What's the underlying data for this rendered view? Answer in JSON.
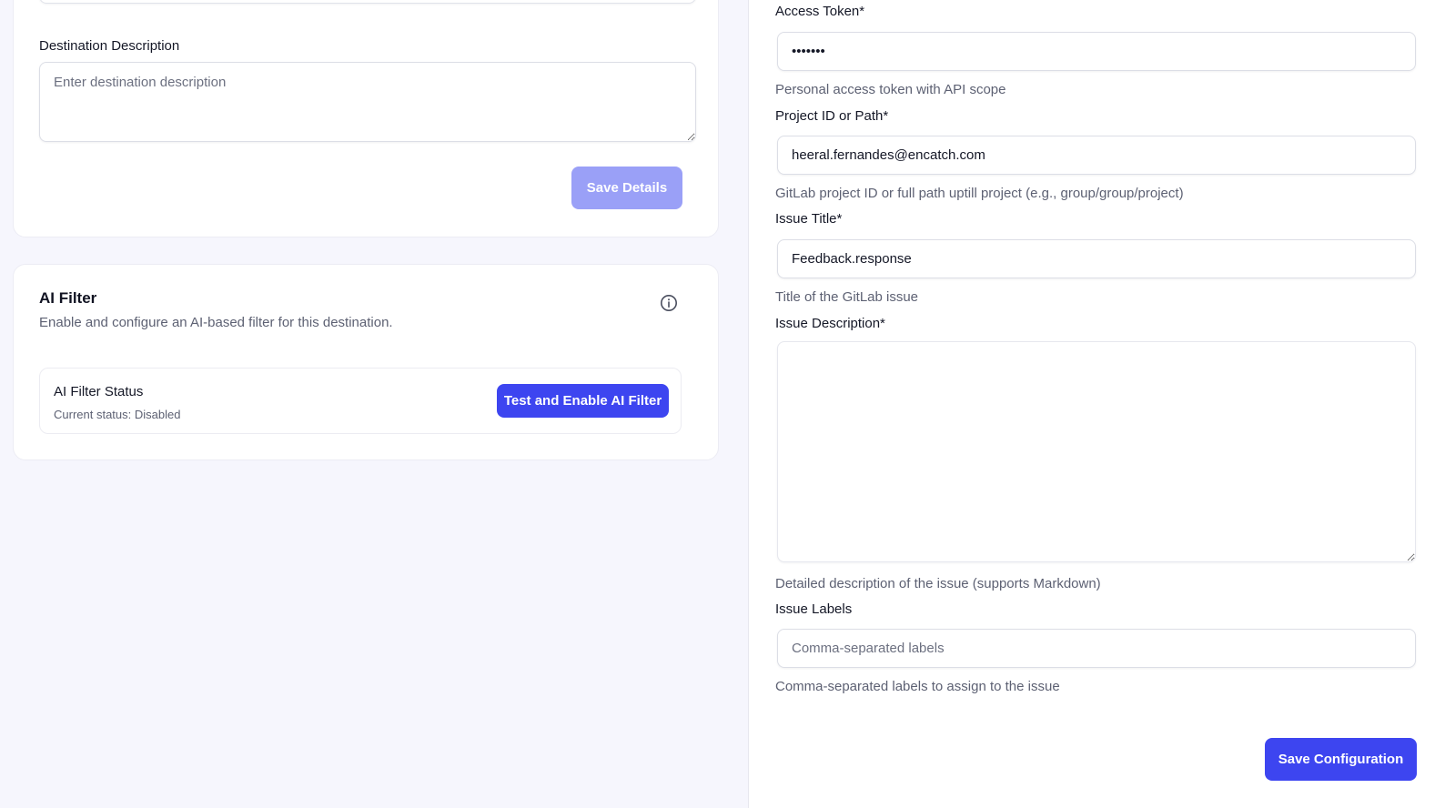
{
  "left": {
    "destination_description": {
      "label": "Destination Description",
      "placeholder": "Enter destination description",
      "value": ""
    },
    "save_details_label": "Save Details",
    "ai_filter": {
      "title": "AI Filter",
      "subtitle": "Enable and configure an AI-based filter for this destination.",
      "info_icon": "info-circle-icon",
      "status_title": "AI Filter Status",
      "status_text": "Current status: Disabled",
      "button_label": "Test and Enable AI Filter"
    }
  },
  "right": {
    "access_token": {
      "label": "Access Token*",
      "value": "•••••••",
      "help": "Personal access token with API scope"
    },
    "project": {
      "label": "Project ID or Path*",
      "value": "heeral.fernandes@encatch.com",
      "help": "GitLab project ID or full path uptill project (e.g., group/group/project)"
    },
    "issue_title": {
      "label": "Issue Title*",
      "value": "Feedback.response",
      "help": "Title of the GitLab issue"
    },
    "issue_description": {
      "label": "Issue Description*",
      "value": "",
      "help": "Detailed description of the issue (supports Markdown)"
    },
    "issue_labels": {
      "label": "Issue Labels",
      "placeholder": "Comma-separated labels",
      "value": "",
      "help": "Comma-separated labels to assign to the issue"
    },
    "save_configuration_label": "Save Configuration"
  },
  "colors": {
    "primary": "#3d45f0",
    "primary_disabled": "#9aa0f7",
    "page_bg": "#f6f6fd",
    "muted_text": "#5d6173"
  }
}
